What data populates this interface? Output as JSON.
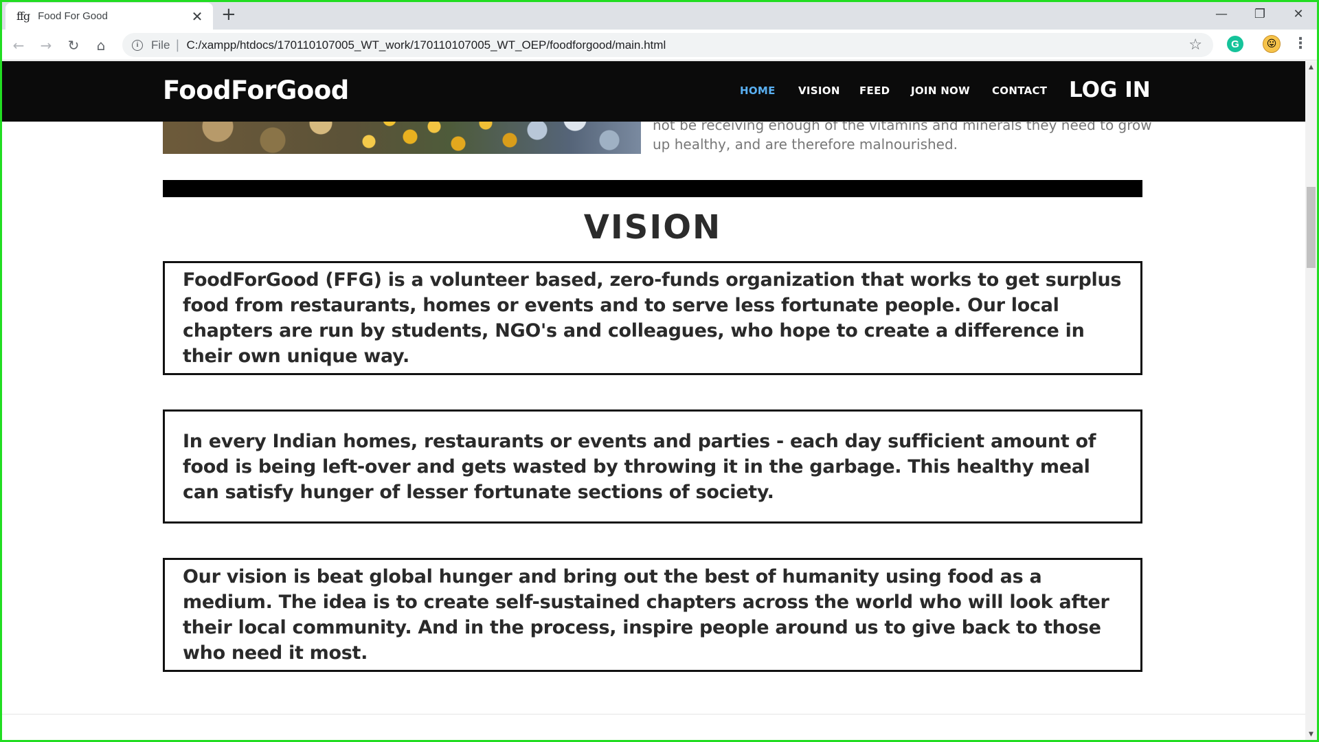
{
  "browser": {
    "tab": {
      "favicon_text": "ffg",
      "title": "Food For Good",
      "close_symbol": "✕"
    },
    "new_tab_symbol": "+",
    "window_controls": {
      "minimize": "—",
      "restore": "❐",
      "close": "✕"
    },
    "nav": {
      "back": "←",
      "forward": "→",
      "reload": "↻",
      "home": "⌂"
    },
    "address": {
      "scheme_label": "File",
      "separator": "|",
      "url": "C:/xampp/htdocs/170110107005_WT_work/170110107005_WT_OEP/foodforgood/main.html"
    },
    "star_symbol": "☆",
    "extensions": {
      "grammarly_letter": "G",
      "face_symbol": "😛"
    },
    "menu_symbol": "⋮"
  },
  "site": {
    "logo": "FoodForGood",
    "nav": [
      {
        "label": "HOME",
        "active": true
      },
      {
        "label": "VISION",
        "active": false
      },
      {
        "label": "FEED",
        "active": false
      },
      {
        "label": "JOIN NOW",
        "active": false
      },
      {
        "label": "CONTACT",
        "active": false
      }
    ],
    "login": "LOG IN",
    "accent_color": "#5ab0f2"
  },
  "content": {
    "intro_text": "not be receiving enough of the vitamins and minerals they need to grow up healthy, and are therefore malnourished.",
    "vision_heading": "VISION",
    "cards": [
      "FoodForGood (FFG) is a volunteer based, zero-funds organization that works to get surplus food from restaurants, homes or events and to serve less fortunate people. Our local chapters are run by students, NGO's and colleagues, who hope to create a difference in their own unique way.",
      "In every Indian homes, restaurants or events and parties - each day sufficient amount of food is being left-over and gets wasted by throwing it in the garbage. This healthy meal can satisfy hunger of lesser fortunate sections of society.",
      "Our vision is beat global hunger and bring out the best of humanity using food as a medium. The idea is to create self-sustained chapters across the world who will look after their local community. And in the process, inspire people around us to give back to those who need it most."
    ]
  },
  "scrollbar": {
    "up": "▲",
    "down": "▼"
  }
}
